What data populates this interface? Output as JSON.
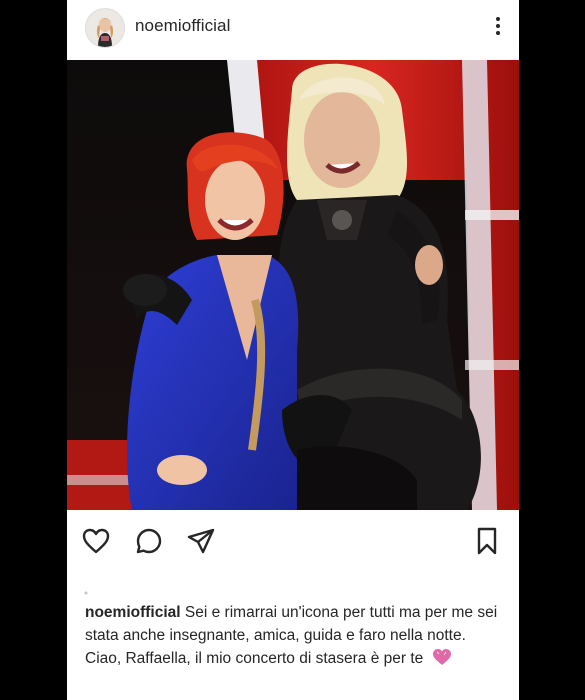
{
  "post": {
    "username": "noemiofficial",
    "more_icon": "more-vertical-icon",
    "photo_alt": "",
    "actions": {
      "like_icon": "heart-icon",
      "comment_icon": "comment-icon",
      "share_icon": "paper-plane-icon",
      "save_icon": "bookmark-icon"
    },
    "caption": {
      "username": "noemiofficial",
      "line1": "Sei e rimarrai un'icona per tutti ma per me sei stata anche insegnante, amica, guida e faro nella notte.",
      "line2": "Ciao, Raffaella, il mio concerto di stasera è per te",
      "emoji_icon": "pink-heart-icon"
    }
  },
  "colors": {
    "background": "#000000",
    "card": "#ffffff",
    "text": "#262626",
    "chair_red": "#c8201c",
    "heart_pink": "#e06aa8"
  }
}
